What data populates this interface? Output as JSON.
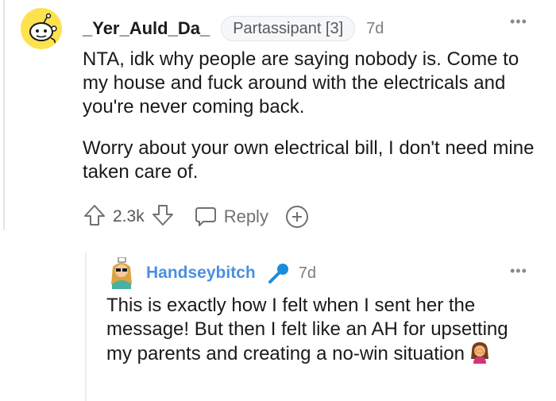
{
  "comment1": {
    "username": "_Yer_Auld_Da_",
    "flair": "Partassipant [3]",
    "age": "7d",
    "paragraphs": [
      "NTA, idk why people are saying nobody is. Come to my house and fuck around with the electricals and you're never coming back.",
      "Worry about your own electrical bill, I don't need mine taken care of."
    ],
    "votes": "2.3k",
    "reply_label": "Reply",
    "more_label": "•••"
  },
  "comment2": {
    "username": "Handseybitch",
    "age": "7d",
    "text": "This is exactly how I felt when I sent her the message! But then I felt like an AH for upsetting my parents and creating a no-win situation",
    "more_label": "•••"
  },
  "colors": {
    "username2": "#4a90e2",
    "mic": "#1a8cde",
    "avatar1_bg": "#fde24f"
  },
  "icons": [
    "snoo-avatar",
    "upvote-icon",
    "downvote-icon",
    "reply-icon",
    "award-icon",
    "mic-icon",
    "facepalm-emoji"
  ]
}
